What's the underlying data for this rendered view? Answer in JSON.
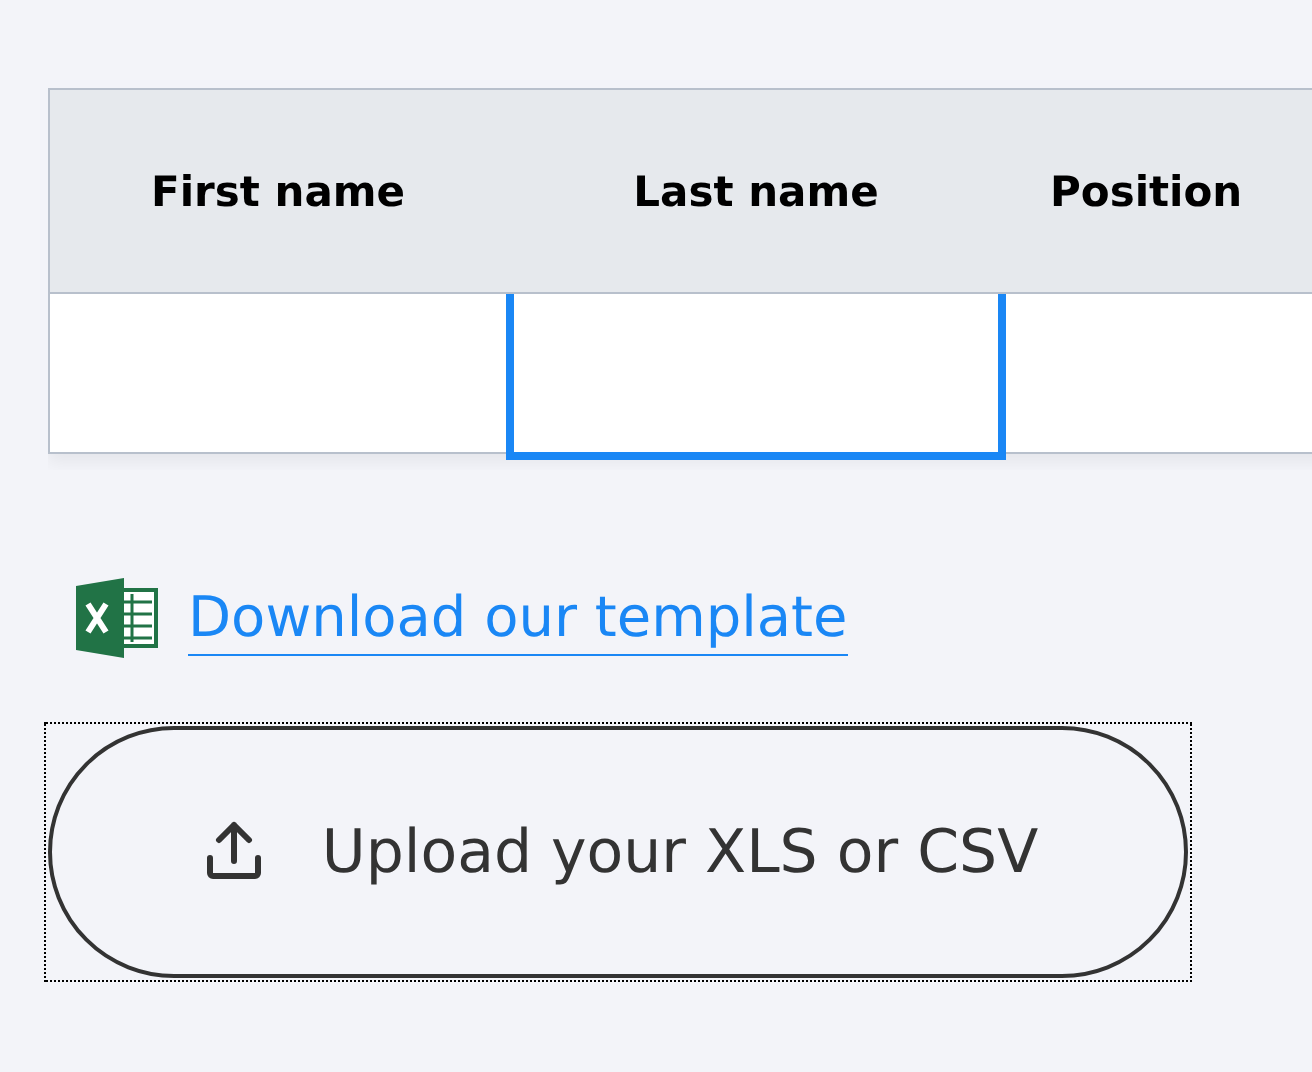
{
  "table": {
    "columns": [
      {
        "label": "First name"
      },
      {
        "label": "Last name"
      },
      {
        "label": "Position"
      }
    ],
    "rows": [
      {
        "cells": [
          {
            "selected": false
          },
          {
            "selected": true
          },
          {
            "selected": false
          }
        ]
      }
    ]
  },
  "template_link": {
    "label": "Download our template"
  },
  "upload_button": {
    "label": "Upload your XLS or CSV",
    "focused": true
  }
}
